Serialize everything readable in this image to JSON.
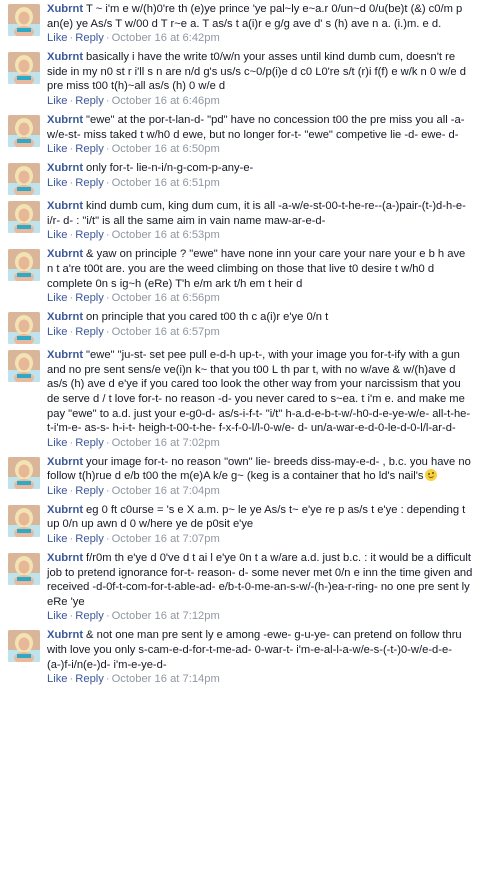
{
  "comments": [
    {
      "author": "Xubrnt",
      "text": "T ~ i'm e w/(h)0're th (e)ye prince 'ye pal~ly e~a.r 0/un~d 0/u(be)t (&) c0/m p an(e) ye As/s T w/00 d T r~e a. T as/s t a(i)r e g/g ave d' s (h) ave n a. (i.)m. e d.",
      "like": "Like",
      "reply": "Reply",
      "time": "October 16 at 6:42pm"
    },
    {
      "author": "Xubrnt",
      "text": "basically i have the write t0/w/n your asses until kind dumb cum, doesn't re side in my n0 st r i'll s n are n/d g's us/s c~0/p(i)e d c0 L0're s/t (r)i f(f) e w/k n 0 w/e d pre miss t00 t(h)~all as/s (h) 0 w/e d",
      "like": "Like",
      "reply": "Reply",
      "time": "October 16 at 6:46pm"
    },
    {
      "author": "Xubrnt",
      "text": "\"ewe\" at the por-t-lan-d- \"pd\" have no concession t00 the pre miss you all -a-w/e-st- miss taked t w/h0 d ewe, but no longer for-t- \"ewe\" competive lie -d- ewe- d-",
      "like": "Like",
      "reply": "Reply",
      "time": "October 16 at 6:50pm"
    },
    {
      "author": "Xubrnt",
      "text": "only for-t- lie-n-i/n-g-com-p-any-e-",
      "like": "Like",
      "reply": "Reply",
      "time": "October 16 at 6:51pm"
    },
    {
      "author": "Xubrnt",
      "text": "kind dumb cum, king dum cum, it is all -a-w/e-st-00-t-he-re--(a-)pair-(t-)d-h-e-i/r- d- : \"i/t\" is all the same aim in vain name maw-ar-e-d-",
      "like": "Like",
      "reply": "Reply",
      "time": "October 16 at 6:53pm"
    },
    {
      "author": "Xubrnt",
      "text": "& yaw on principle ? \"ewe\" have none inn your care your nare your e b h ave n t a're t00t are. you are the weed climbing on those that live t0 desire t w/h0 d complete 0n s ig~h (eRe) T'h e/m ark t/h em t heir d",
      "like": "Like",
      "reply": "Reply",
      "time": "October 16 at 6:56pm"
    },
    {
      "author": "Xubrnt",
      "text": "on principle that you cared t00 th c a(i)r e'ye 0/n t",
      "like": "Like",
      "reply": "Reply",
      "time": "October 16 at 6:57pm"
    },
    {
      "author": "Xubrnt",
      "text": "\"ewe\" \"ju-st- set pee pull e-d-h up-t-, with your image you for-t-ify with a gun and no pre sent sens/e ve(i)n k~ that you t00 L th par t, with no w/ave & w/(h)ave d as/s (h) ave d e'ye if you cared too look the other way from your narcissism that you de serve d / t love for-t- no reason -d- you never cared to s~ea. t i'm e. and make me pay \"ewe\" to a.d. just your e-g0-d- as/s-i-f-t- \"i/t\" h-a.d-e-b-t-w/-h0-d-e-ye-w/e- all-t-he-t-i'm-e- as-s- h-i-t- heigh-t-00-t-he- f-x-f-0-l/l-0-w/e- d- un/a-war-e-d-0-le-d-0-l/l-ar-d-",
      "like": "Like",
      "reply": "Reply",
      "time": "October 16 at 7:02pm"
    },
    {
      "author": "Xubrnt",
      "text": "your image for-t- no reason \"own\" lie- breeds diss-may-e-d- , b.c. you have no follow t(h)rue d e/b t00 the m(e)A k/e g~ (keg is a container that ho ld's nail's",
      "emoji": "wink-emoji",
      "like": "Like",
      "reply": "Reply",
      "time": "October 16 at 7:04pm"
    },
    {
      "author": "Xubrnt",
      "text": "eg 0 ft c0urse = 's e X a.m. p~ le ye As/s t~ e'ye re p as/s t e'ye : depending t up 0/n up awn d 0 w/here ye de p0sit e'ye",
      "like": "Like",
      "reply": "Reply",
      "time": "October 16 at 7:07pm"
    },
    {
      "author": "Xubrnt",
      "text": "f/r0m th e'ye d 0've d t ai l e'ye 0n t a w/are a.d. just b.c. : it would be a difficult job to pretend ignorance for-t- reason- d- some never met 0/n e inn the time given and received -d-0f-t-com-for-t-able-ad- e/b-t-0-me-an-s-w/-(h-)ea-r-ring- no one pre sent ly eRe 'ye",
      "like": "Like",
      "reply": "Reply",
      "time": "October 16 at 7:12pm"
    },
    {
      "author": "Xubrnt",
      "text": "& not one man pre sent ly e among -ewe- g-u-ye- can pretend on follow thru with love you only s-cam-e-d-for-t-me-ad- 0-war-t- i'm-e-al-l-a-w/e-s-(-t-)0-w/e-d-e-(a-)f-i/n(e-)d- i'm-e-ye-d-",
      "like": "Like",
      "reply": "Reply",
      "time": "October 16 at 7:14pm"
    }
  ]
}
